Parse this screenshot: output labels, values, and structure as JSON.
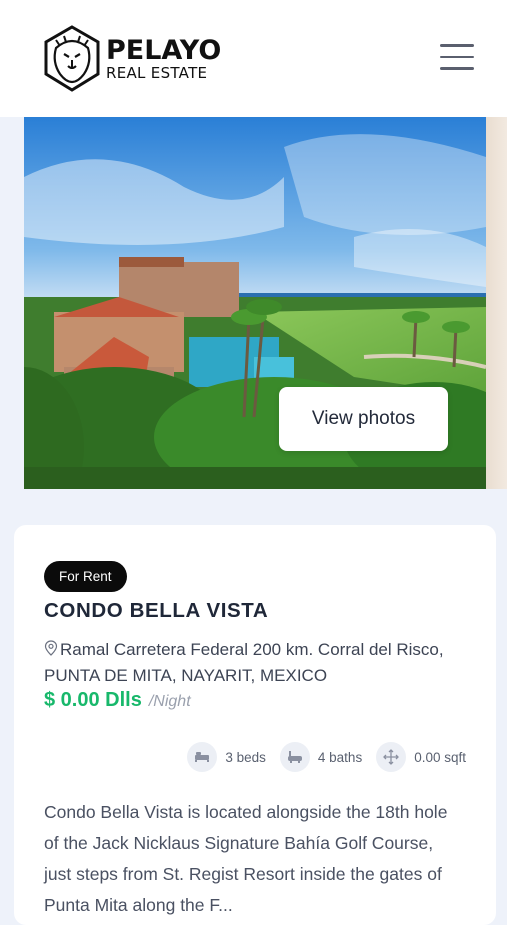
{
  "brand": {
    "name": "PELAYO",
    "tagline": "REAL ESTATE"
  },
  "gallery": {
    "button_label": "View photos"
  },
  "listing": {
    "status": "For Rent",
    "title": "CONDO BELLA VISTA",
    "address": "Ramal Carretera Federal 200 km. Corral del Risco, PUNTA DE MITA, NAYARIT, MEXICO",
    "price": "$ 0.00 Dlls",
    "price_unit": "/Night",
    "features": {
      "beds": "3 beds",
      "baths": "4 baths",
      "area": "0.00 sqft"
    },
    "description": "Condo Bella Vista is located alongside the 18th hole of the Jack Nicklaus Signature Bahía Golf Course, just steps from St. Regist Resort inside the gates of Punta Mita along the F..."
  },
  "colors": {
    "accent_green": "#18b86b",
    "badge_bg": "#0b0b0b",
    "page_bg": "#eef2fa"
  }
}
